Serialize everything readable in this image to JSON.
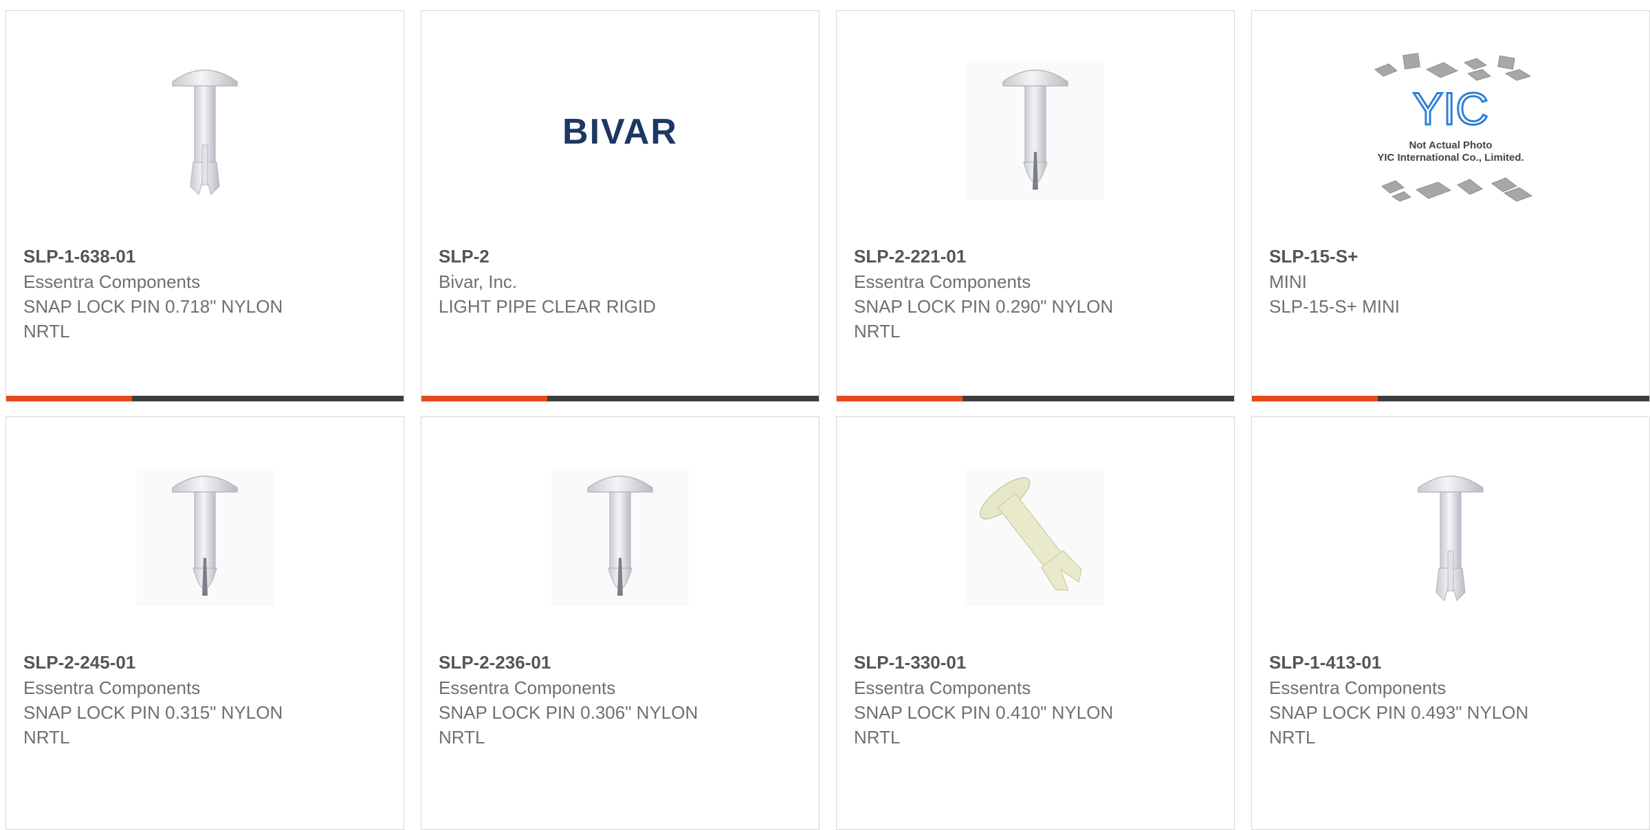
{
  "colors": {
    "accent": "#e84a1b",
    "bar": "#3d3d3d",
    "border": "#d6d6d6",
    "brand_bivar": "#1d3763"
  },
  "products": [
    {
      "part": "SLP-1-638-01",
      "manufacturer": "Essentra Components",
      "description": "SNAP LOCK PIN 0.718\" NYLON NRTL",
      "image": "snap-lock-pin-split"
    },
    {
      "part": "SLP-2",
      "manufacturer": "Bivar, Inc.",
      "description": "LIGHT PIPE CLEAR RIGID",
      "image": "bivar-logo",
      "logo_text": "BIVAR"
    },
    {
      "part": "SLP-2-221-01",
      "manufacturer": "Essentra Components",
      "description": "SNAP LOCK PIN 0.290\" NYLON NRTL",
      "image": "snap-lock-pin"
    },
    {
      "part": "SLP-15-S+",
      "manufacturer": "MINI",
      "description": "SLP-15-S+ MINI",
      "image": "yic-placeholder",
      "placeholder_text": [
        "Not Actual Photo",
        "YIC International Co., Limited."
      ],
      "logo_text": "YIC"
    },
    {
      "part": "SLP-2-245-01",
      "manufacturer": "Essentra Components",
      "description": "SNAP LOCK PIN 0.315\" NYLON NRTL",
      "image": "snap-lock-pin"
    },
    {
      "part": "SLP-2-236-01",
      "manufacturer": "Essentra Components",
      "description": "SNAP LOCK PIN 0.306\" NYLON NRTL",
      "image": "snap-lock-pin"
    },
    {
      "part": "SLP-1-330-01",
      "manufacturer": "Essentra Components",
      "description": "SNAP LOCK PIN 0.410\" NYLON NRTL",
      "image": "snap-lock-pin-tilted"
    },
    {
      "part": "SLP-1-413-01",
      "manufacturer": "Essentra Components",
      "description": "SNAP LOCK PIN 0.493\" NYLON NRTL",
      "image": "snap-lock-pin-split"
    }
  ]
}
